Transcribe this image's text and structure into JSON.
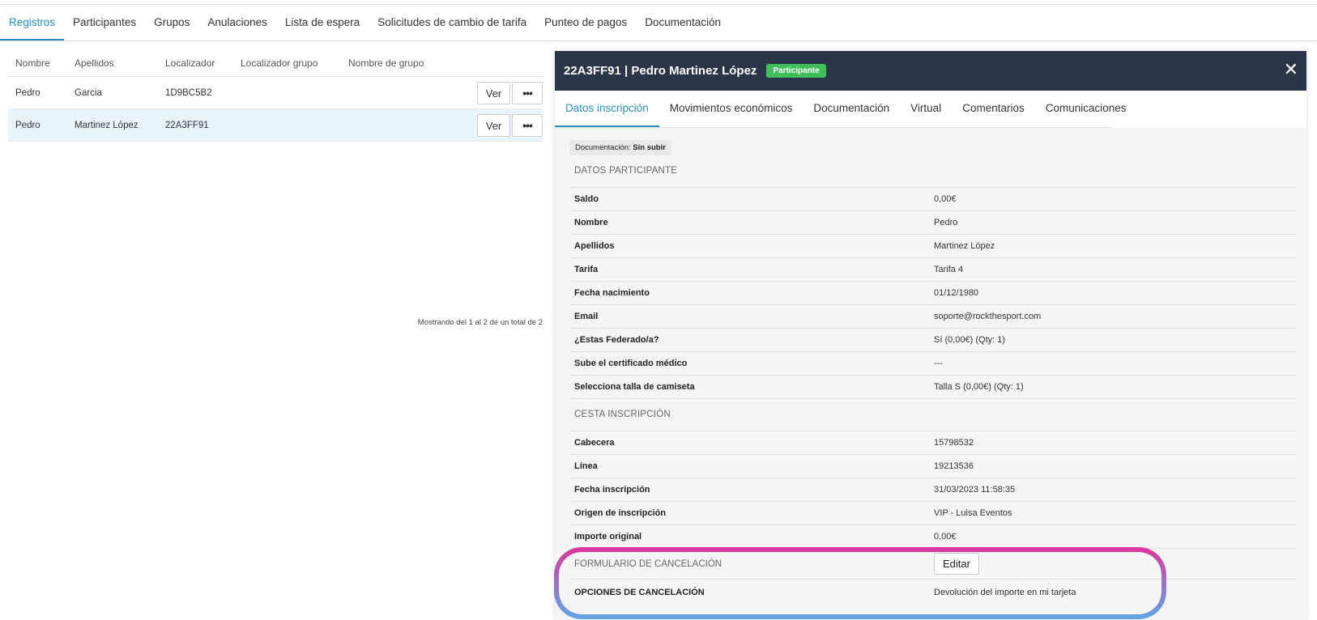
{
  "top_tabs": [
    {
      "label": "Registros"
    },
    {
      "label": "Participantes"
    },
    {
      "label": "Grupos"
    },
    {
      "label": "Anulaciones"
    },
    {
      "label": "Lista de espera"
    },
    {
      "label": "Solicitudes de cambio de tarifa"
    },
    {
      "label": "Punteo de pagos"
    },
    {
      "label": "Documentación"
    }
  ],
  "table": {
    "headers": [
      "Nombre",
      "Apellidos",
      "Localizador",
      "Localizador grupo",
      "Nombre de grupo"
    ],
    "rows": [
      {
        "nombre": "Pedro",
        "apellidos": "Garcia",
        "localizador": "1D9BC5B2",
        "localizador_grupo": "",
        "nombre_grupo": "",
        "ver": "Ver",
        "more": "•••"
      },
      {
        "nombre": "Pedro",
        "apellidos": "Martinez López",
        "localizador": "22A3FF91",
        "localizador_grupo": "",
        "nombre_grupo": "",
        "ver": "Ver",
        "more": "•••"
      }
    ],
    "showing": "Mostrando del 1 al 2 de un total de 2"
  },
  "panel": {
    "title": "22A3FF91 | Pedro Martinez López",
    "badge": "Participante",
    "close": "✕",
    "tabs": [
      "Datos inscripción",
      "Movimientos económicos",
      "Documentación",
      "Virtual",
      "Comentarios",
      "Comunicaciones"
    ],
    "doc_chip_label": "Documentación:",
    "doc_chip_value": "Sin subir",
    "participante_title": "DATOS PARTICIPANTE",
    "participante": [
      {
        "k": "Saldo",
        "v": "0,00€"
      },
      {
        "k": "Nombre",
        "v": "Pedro"
      },
      {
        "k": "Apellidos",
        "v": "Martinez López"
      },
      {
        "k": "Tarifa",
        "v": "Tarifa 4"
      },
      {
        "k": "Fecha nacimiento",
        "v": "01/12/1980"
      },
      {
        "k": "Email",
        "v": "soporte@rockthesport.com"
      },
      {
        "k": "¿Estas Federado/a?",
        "v": "Sí (0,00€) (Qty: 1)"
      },
      {
        "k": "Sube el certificado médico",
        "v": "---"
      },
      {
        "k": "Selecciona talla de camiseta",
        "v": "Talla S (0,00€) (Qty: 1)"
      }
    ],
    "cesta_title": "CESTA INSCRIPCIÓN",
    "cesta": [
      {
        "k": "Cabecera",
        "v": "15798532"
      },
      {
        "k": "Línea",
        "v": "19213536"
      },
      {
        "k": "Fecha inscripción",
        "v": "31/03/2023 11:58:35"
      },
      {
        "k": "Origen de inscripción",
        "v": "VIP - Luisa Eventos"
      },
      {
        "k": "Importe original",
        "v": "0,00€"
      }
    ],
    "cancel_title": "FORMULARIO DE CANCELACIÓN",
    "edit_label": "Editar",
    "cancel_option_k": "OPCIONES DE CANCELACIÓN",
    "cancel_option_v": "Devolución del importe en mi tarjeta"
  },
  "colors": {
    "accent": "#2a8fbd",
    "header_bg": "#2a3547",
    "badge_green": "#3fbf5a",
    "highlight_top": "#e0359a",
    "highlight_bottom": "#5ea6e6"
  }
}
